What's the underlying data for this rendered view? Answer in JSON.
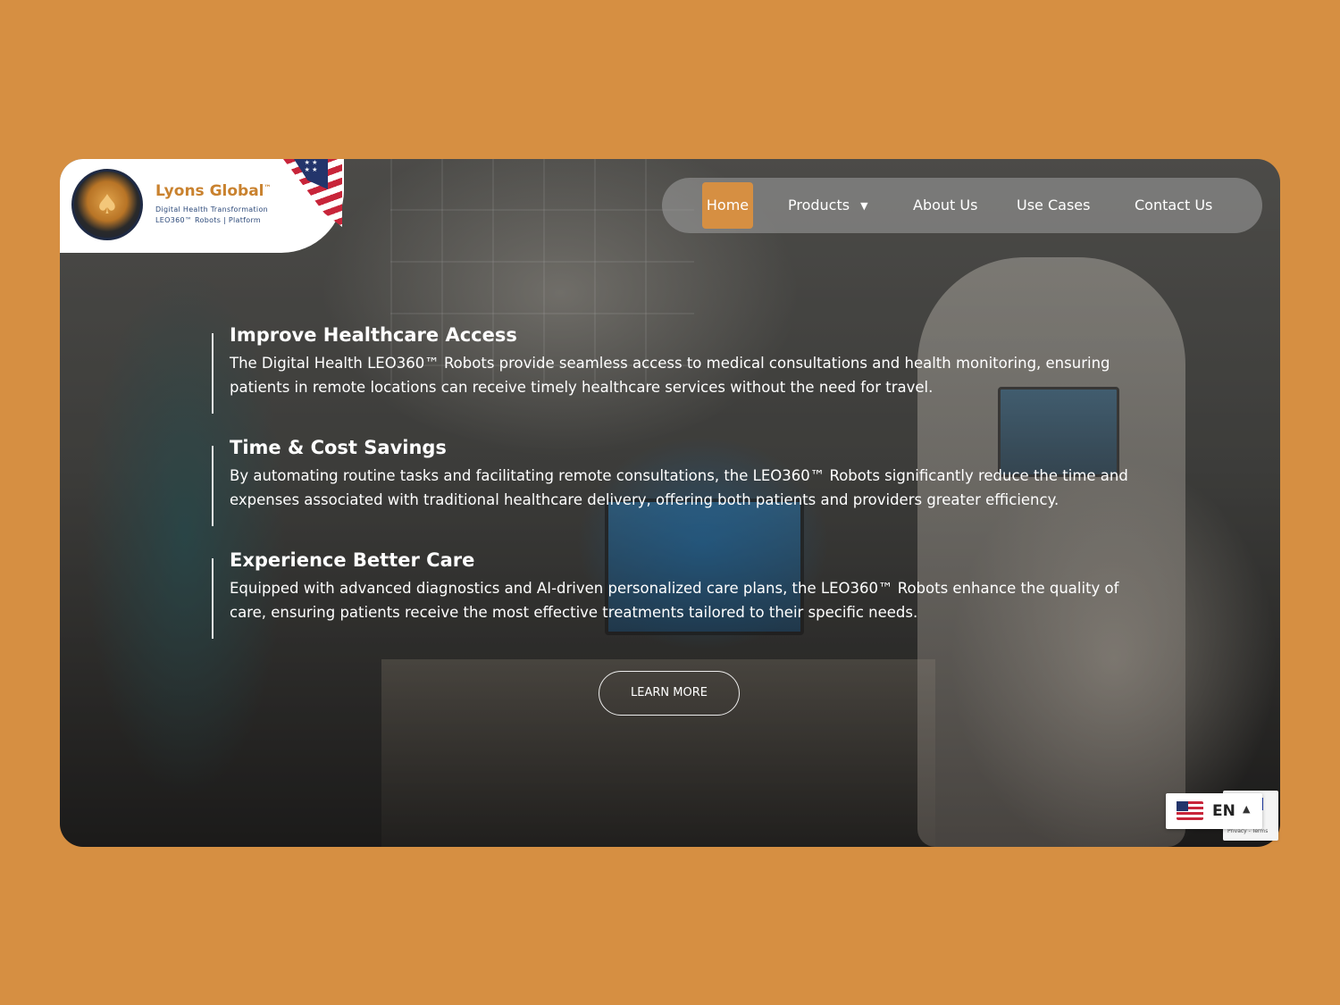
{
  "brand": {
    "name": "Lyons Global",
    "trademark": "™",
    "tagline_1": "Digital Health Transformation",
    "tagline_2": "LEO360™ Robots | Platform",
    "emblem_text": "LYONS GLOBAL"
  },
  "nav": {
    "items": [
      {
        "label": "Home",
        "active": true
      },
      {
        "label": "Products",
        "has_dropdown": true
      },
      {
        "label": "About Us"
      },
      {
        "label": "Use Cases"
      },
      {
        "label": "Contact Us"
      }
    ]
  },
  "features": [
    {
      "title": "Improve Healthcare Access",
      "text": "The Digital Health LEO360™ Robots provide seamless access to medical consultations and health monitoring, ensuring patients in remote locations can receive timely healthcare services without the need for travel."
    },
    {
      "title": "Time & Cost Savings",
      "text": "By automating routine tasks and facilitating remote consultations, the LEO360™ Robots significantly reduce the time and expenses associated with traditional healthcare delivery, offering both patients and providers greater efficiency."
    },
    {
      "title": "Experience Better Care",
      "text": "Equipped with advanced diagnostics and AI-driven personalized care plans, the LEO360™ Robots enhance the quality of care, ensuring patients receive the most effective treatments tailored to their specific needs."
    }
  ],
  "cta": {
    "label": "LEARN MORE"
  },
  "language": {
    "code": "EN",
    "flag": "us-flag-icon"
  },
  "recaptcha": {
    "text": "Privacy - Terms"
  },
  "colors": {
    "background": "#D68F42",
    "accent": "#D68F42",
    "brand_text": "#C9822F",
    "white": "#FFFFFF"
  }
}
